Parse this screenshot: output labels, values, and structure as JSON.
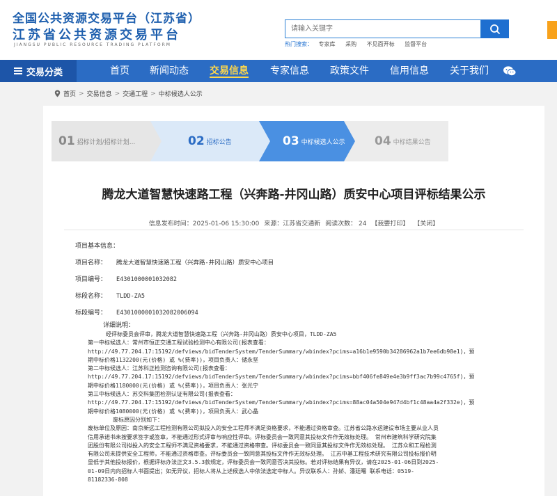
{
  "header": {
    "logo_line1": "全国公共资源交易平台（江苏省）",
    "logo_line2": "江苏省公共资源交易平台",
    "logo_en": "JIANGSU PUBLIC RESOURCE TRADING PLATFORM",
    "search_placeholder": "请输入关键字",
    "hot_label": "热门搜索：",
    "hot_items": [
      "专家库",
      "采购",
      "不见面开标",
      "监督平台"
    ]
  },
  "nav": {
    "category_label": "交易分类",
    "items": [
      "首页",
      "新闻动态",
      "交易信息",
      "专家信息",
      "政策文件",
      "信用信息",
      "关于我们"
    ],
    "active_index": 2
  },
  "breadcrumb": [
    "首页",
    "交易信息",
    "交通工程",
    "中标候选人公示"
  ],
  "steps": [
    {
      "num": "01",
      "label": "招标计划/招标计划..."
    },
    {
      "num": "02",
      "label": "招标公告"
    },
    {
      "num": "03",
      "label": "中标候选人公示"
    },
    {
      "num": "04",
      "label": "中标结果公告"
    }
  ],
  "active_step": 2,
  "article": {
    "title": "腾龙大道智慧快速路工程（兴奔路-井冈山路）质安中心项目评标结果公示",
    "meta": {
      "publish_time": "信息发布时间：2025-01-06 15:30:00",
      "source": "来源：江苏省交通新",
      "views": "阅读次数：  24",
      "print": "【我要打印】",
      "close": "【关闭】"
    },
    "basic_info_label": "项目基本信息：",
    "project_name_label": "项目名称：",
    "project_name": "腾龙大道智慧快速路工程（兴奔路-井冈山路）质安中心项目",
    "project_no_label": "项目编号：",
    "project_no": "E4301000001032082",
    "section_name_label": "标段名称：",
    "section_name": "TLDD-ZA5",
    "section_no_label": "标段编号：",
    "section_no": "E4301000001032082006094",
    "detail_label": "详细说明：",
    "body": [
      "经评标委员会评审，腾龙大道智慧快速路工程（兴奔路-井冈山路）质安中心项目，TLDD-ZA5",
      "第一中标候选人：常州市恒正交通工程试验检测中心有限公司(报表查看：",
      "http://49.77.204.17:15192/defviews/bidTenderSystem/TenderSummary/wbindex?pcims=a16b1e9590b34286962a1b7ee6db98e1)，预",
      "期中标价格1132200(元(价格) 或 %(费率))，项目负责人：储永坚",
      "第二中标候选人：江苏科正检测咨询有限公司(报表查看：",
      "http://49.77.204.17:15192/defviews/bidTenderSystem/TenderSummary/wbindex?pcims=bbf406fe849e4e3b9ff3ac7b99c4765f)，预",
      "期中标价格1180000(元(价格) 或 %(费率))，项目负责人：张光宁",
      "第三中标候选人：苏交科集团检测认证有限公司(报表查看：",
      "http://49.77.204.17:15192/defviews/bidTenderSystem/TenderSummary/wbindex?pcims=88ac04a504e947d4bf1c48aa4a2f332e)，预",
      "期中标价格1080000(元(价格) 或 %(费率))，项目负责人：武心晶",
      "废标原因分别如下：",
      "废标单位及原因：南京新远工程检测有限公司拟投入的安全工程师不满足资格要求，不能通过资格审查。江苏省公路水运建设市场主要从业人员",
      "信用承诺书未按要求签字或签章，不能通过形式评审与响应性评审。评标委员会一致同意其投标文件作无效标处理。 常州市建筑科学研究院集",
      "团股份有限公司拟投入的安全工程师不满足资格要求，不能通过资格审查。评标委员会一致同意其投标文件作无效标处理。 江苏众和工程检测",
      "有限公司未提供安全工程师，不能通过资格审查。评标委员会一致同意其投标文件作无效标处理。 江苏中基工程技术研究有限公司投标报价明",
      "显低于其他投标报价，根据评标办法正文3.5.3款规定，评标委员会一致同意否决其投标。若对评标结果有异议，请在2025-01-06日到2025-",
      "01-09日内向招标人书面提出；如无异议，招标人将从上述候选人中依法选定中标人。异议联系人：孙娇、潘廷曙      联系电话：0519-",
      "81182336-808"
    ]
  },
  "colors": {
    "nav_bg": "#2b6cc4",
    "brand_blue": "#1e5fae",
    "active_nav": "#ffd84a",
    "step_active": "#4a90e2",
    "step_done": "#dbe9f8",
    "step_pending": "#e6e6e6"
  }
}
